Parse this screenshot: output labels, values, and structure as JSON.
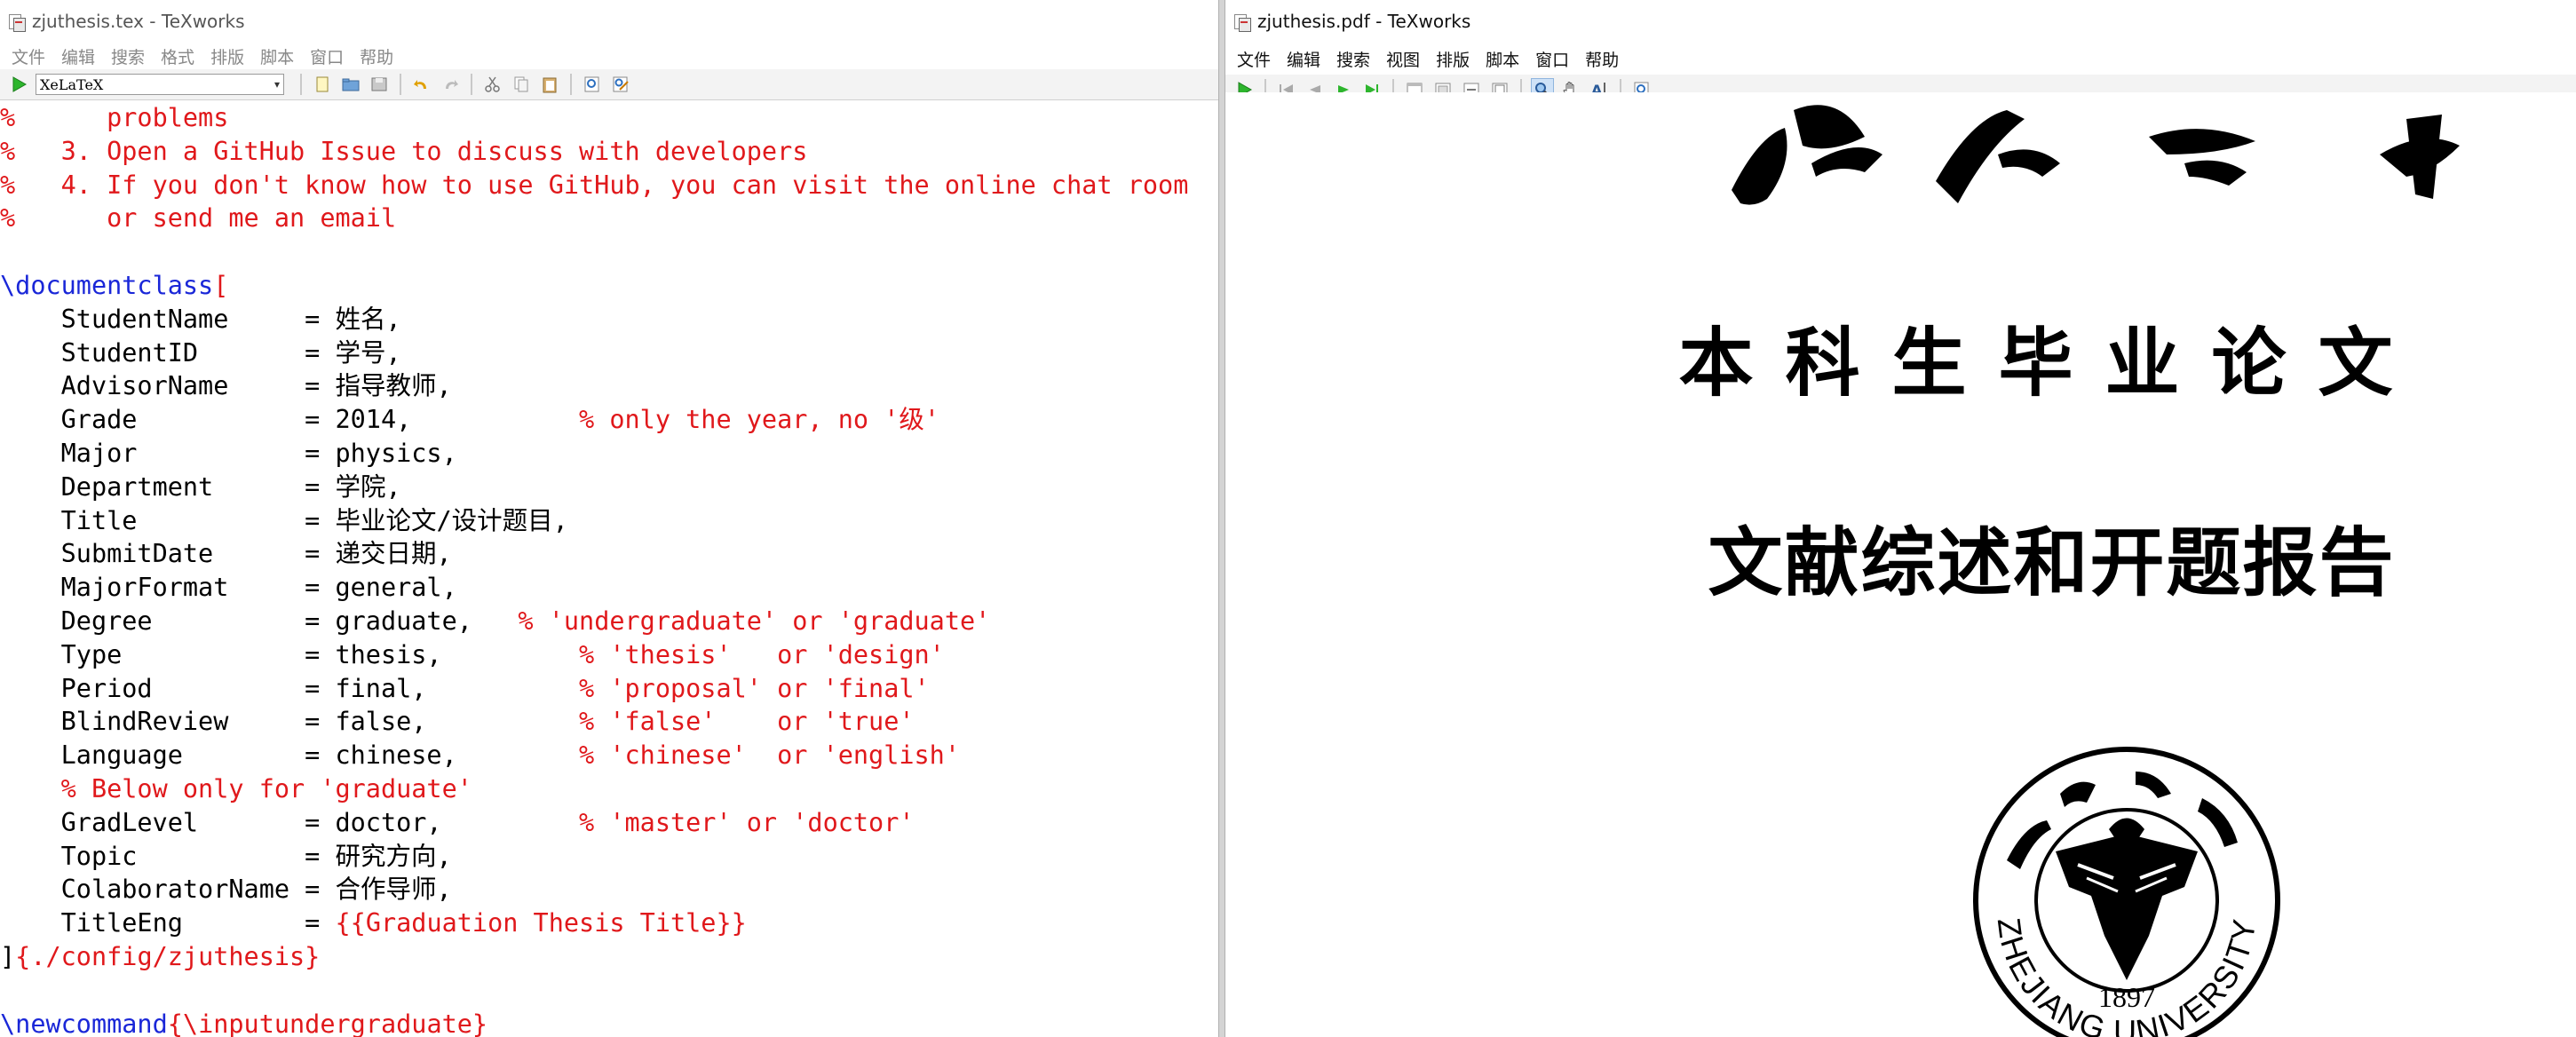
{
  "left_window": {
    "title": "zjuthesis.tex - TeXworks",
    "menu": [
      "文件",
      "编辑",
      "搜索",
      "格式",
      "排版",
      "脚本",
      "窗口",
      "帮助"
    ],
    "engine": "XeLaTeX"
  },
  "right_window": {
    "title": "zjuthesis.pdf - TeXworks",
    "menu": [
      "文件",
      "编辑",
      "搜索",
      "视图",
      "排版",
      "脚本",
      "窗口",
      "帮助"
    ]
  },
  "editor_lines": [
    {
      "a": "%      problems",
      "b": "",
      "c": "",
      "d": ""
    },
    {
      "a": "%   3. Open a GitHub Issue to discuss with developers",
      "b": "",
      "c": "",
      "d": ""
    },
    {
      "a": "%   4. If you don't know how to use GitHub, you can visit the online chat room",
      "b": "",
      "c": "",
      "d": ""
    },
    {
      "a": "%      or send me an email",
      "b": "",
      "c": "",
      "d": ""
    },
    {
      "a": "",
      "b": "",
      "c": "",
      "d": ""
    },
    {
      "a": "",
      "b": "\\documentclass",
      "c": "",
      "d": "["
    },
    {
      "a": "",
      "b": "",
      "c": "    StudentName     = 姓名,",
      "d": ""
    },
    {
      "a": "",
      "b": "",
      "c": "    StudentID       = 学号,",
      "d": ""
    },
    {
      "a": "",
      "b": "",
      "c": "    AdvisorName     = 指导教师,",
      "d": ""
    },
    {
      "a": "",
      "b": "",
      "c": "    Grade           = 2014,",
      "d": "           % only the year, no '级'"
    },
    {
      "a": "",
      "b": "",
      "c": "    Major           = physics,",
      "d": ""
    },
    {
      "a": "",
      "b": "",
      "c": "    Department      = 学院,",
      "d": ""
    },
    {
      "a": "",
      "b": "",
      "c": "    Title           = 毕业论文/设计题目,",
      "d": ""
    },
    {
      "a": "",
      "b": "",
      "c": "    SubmitDate      = 递交日期,",
      "d": ""
    },
    {
      "a": "",
      "b": "",
      "c": "    MajorFormat     = general,",
      "d": ""
    },
    {
      "a": "",
      "b": "",
      "c": "    Degree          = graduate,",
      "d": "   % 'undergraduate' or 'graduate'"
    },
    {
      "a": "",
      "b": "",
      "c": "    Type            = thesis,",
      "d": "         % 'thesis'   or 'design'"
    },
    {
      "a": "",
      "b": "",
      "c": "    Period          = final,",
      "d": "          % 'proposal' or 'final'"
    },
    {
      "a": "",
      "b": "",
      "c": "    BlindReview     = false,",
      "d": "          % 'false'    or 'true'"
    },
    {
      "a": "",
      "b": "",
      "c": "    Language        = chinese,",
      "d": "        % 'chinese'  or 'english'"
    },
    {
      "a": "    % Below only for 'graduate'",
      "b": "",
      "c": "",
      "d": ""
    },
    {
      "a": "",
      "b": "",
      "c": "    GradLevel       = doctor,",
      "d": "         % 'master' or 'doctor'"
    },
    {
      "a": "",
      "b": "",
      "c": "    Topic           = 研究方向,",
      "d": ""
    },
    {
      "a": "",
      "b": "",
      "c": "    ColaboratorName = 合作导师,",
      "d": ""
    },
    {
      "a": "",
      "b": "",
      "c": "    TitleEng        = ",
      "d": "{{Graduation Thesis Title}}"
    },
    {
      "a": "",
      "b": "",
      "c": "]",
      "d": "{./config/zjuthesis}"
    },
    {
      "a": "",
      "b": "",
      "c": "",
      "d": ""
    },
    {
      "a": "",
      "b": "\\newcommand",
      "c": "",
      "d": "{\\inputundergraduate}"
    }
  ],
  "pdf": {
    "title_line_1": "本科生毕业论文",
    "title_line_2": "文献综述和开题报告",
    "seal_name": "浙江大学",
    "seal_year": "1897",
    "seal_english": "ZHEJIANG UNIVERSITY",
    "header_calligraphy": "浙江大学"
  },
  "colors": {
    "comment": "#e0181b",
    "command": "#1a27d8",
    "text": "#000000"
  }
}
